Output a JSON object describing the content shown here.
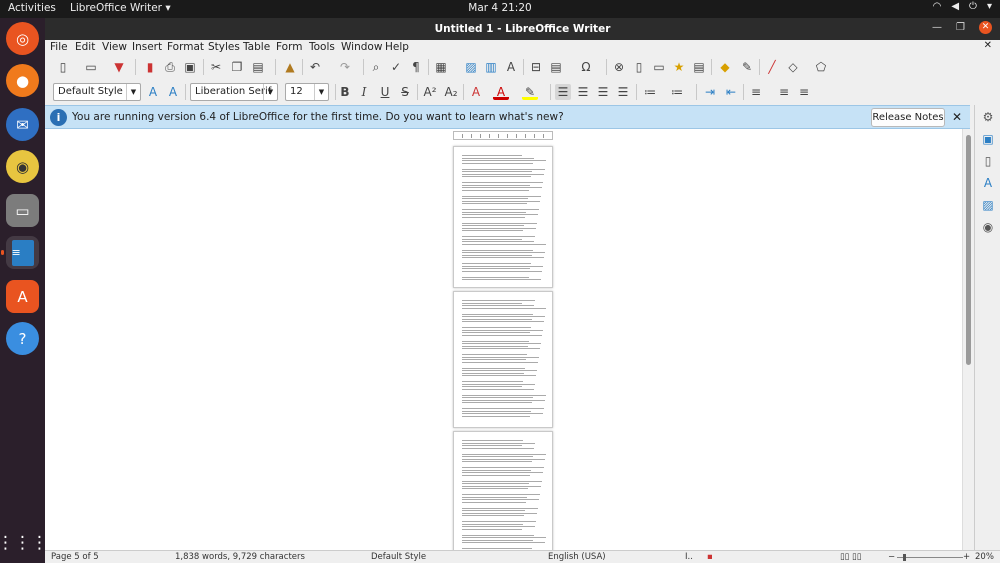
{
  "topbar": {
    "activities": "Activities",
    "app_menu": "LibreOffice Writer ▾",
    "clock": "Mar 4  21:20"
  },
  "dock": {
    "items": [
      "ubuntu-icon",
      "firefox-icon",
      "thunderbird-icon",
      "rhythmbox-icon",
      "files-icon",
      "writer-icon",
      "software-icon",
      "help-icon",
      "apps-grid-icon"
    ]
  },
  "window": {
    "title": "Untitled 1 - LibreOffice Writer"
  },
  "menu": [
    "File",
    "Edit",
    "View",
    "Insert",
    "Format",
    "Styles",
    "Table",
    "Form",
    "Tools",
    "Window",
    "Help"
  ],
  "formatting": {
    "paragraph_style": "Default Style",
    "font_name": "Liberation Serif",
    "font_size": "12"
  },
  "infobar": {
    "message": "You are running version 6.4 of LibreOffice for the first time. Do you want to learn what's new?",
    "button": "Release Notes",
    "close": "✕"
  },
  "status": {
    "page": "Page 5 of 5",
    "words": "1,838 words, 9,729 characters",
    "style": "Default Style",
    "language": "English (USA)",
    "zoom": "20%"
  },
  "colors": {
    "accent": "#e95420",
    "infobar": "#c6e2f6",
    "dock": "#2b1f2b",
    "titlebar": "#2c2c2c"
  }
}
